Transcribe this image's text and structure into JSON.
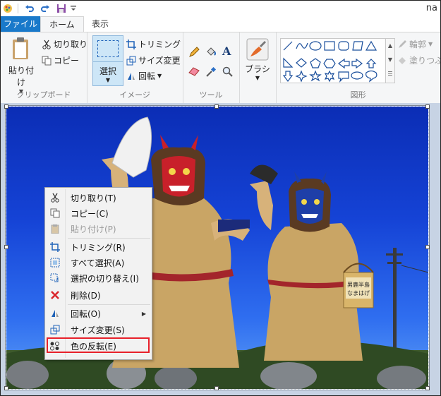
{
  "window": {
    "title_fragment": "na"
  },
  "tabs": {
    "file": "ファイル",
    "home": "ホーム",
    "view": "表示"
  },
  "clipboard": {
    "paste": "貼り付け",
    "cut": "切り取り",
    "copy": "コピー",
    "group": "クリップボード"
  },
  "image_group": {
    "select": "選択",
    "crop": "トリミング",
    "resize": "サイズ変更",
    "rotate": "回転",
    "group": "イメージ"
  },
  "tools_group": {
    "group": "ツール"
  },
  "brushes": {
    "label": "ブラシ"
  },
  "shapes_group": {
    "outline": "輪郭",
    "fill": "塗りつぶし",
    "group": "図形"
  },
  "context_menu": {
    "items": [
      {
        "label": "切り取り(T)",
        "icon": "scissors-icon",
        "enabled": true
      },
      {
        "label": "コピー(C)",
        "icon": "copy-icon",
        "enabled": true
      },
      {
        "label": "貼り付け(P)",
        "icon": "paste-icon",
        "enabled": false
      },
      {
        "label": "トリミング(R)",
        "icon": "crop-icon",
        "enabled": true
      },
      {
        "label": "すべて選択(A)",
        "icon": "select-all-icon",
        "enabled": true
      },
      {
        "label": "選択の切り替え(I)",
        "icon": "invert-selection-icon",
        "enabled": true
      },
      {
        "label": "削除(D)",
        "icon": "delete-x-icon",
        "enabled": true
      },
      {
        "label": "回転(O)",
        "icon": "rotate-icon",
        "enabled": true,
        "submenu": true
      },
      {
        "label": "サイズ変更(S)",
        "icon": "resize-icon",
        "enabled": true
      },
      {
        "label": "色の反転(E)",
        "icon": "invert-color-icon",
        "enabled": true,
        "highlighted": true
      }
    ]
  },
  "image_signs": {
    "sign_line1": "男鹿半島",
    "sign_line2": "なまはげ"
  },
  "colors": {
    "accent": "#1979ca",
    "highlight_border": "#e8202a",
    "sky": "#1543d6"
  }
}
